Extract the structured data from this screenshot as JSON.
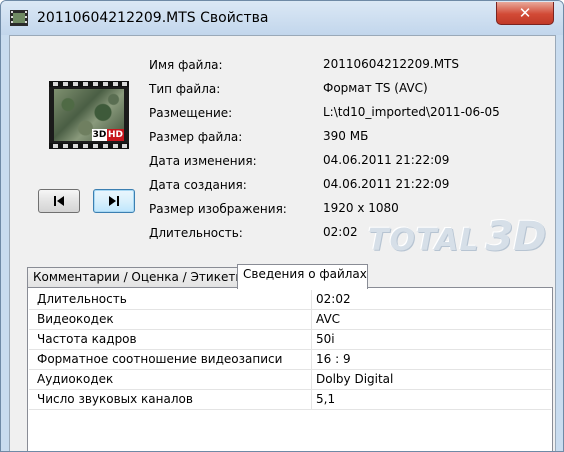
{
  "window": {
    "title": "20110604212209.MTS Свойства",
    "close_label": "✕"
  },
  "thumbnail": {
    "badge_3d": "3D",
    "badge_hd": "HD"
  },
  "nav": {
    "prev_icon": "skip-previous-icon",
    "next_icon": "skip-next-icon"
  },
  "details": [
    {
      "label": "Имя файла:",
      "value": "20110604212209.MTS"
    },
    {
      "label": "Тип файла:",
      "value": "Формат TS (AVC)"
    },
    {
      "label": "Размещение:",
      "value": "L:\\td10_imported\\2011-06-05"
    },
    {
      "label": "Размер файла:",
      "value": "390 МБ"
    },
    {
      "label": "Дата изменения:",
      "value": "04.06.2011 21:22:09"
    },
    {
      "label": "Дата создания:",
      "value": "04.06.2011 21:22:09"
    },
    {
      "label": "Размер изображения:",
      "value": "1920 x 1080"
    },
    {
      "label": "Длительность:",
      "value": "02:02"
    }
  ],
  "logo": {
    "part1": "TOTAL",
    "part2": "3D"
  },
  "tabs": [
    {
      "label": "Комментарии / Оценка / Этикетки",
      "active": false
    },
    {
      "label": "Сведения о файлах",
      "active": true
    }
  ],
  "file_info": [
    {
      "key": "Длительность",
      "value": "02:02"
    },
    {
      "key": "Видеокодек",
      "value": "AVC"
    },
    {
      "key": "Частота кадров",
      "value": "50i"
    },
    {
      "key": "Форматное соотношение видеозаписи",
      "value": "16 : 9"
    },
    {
      "key": "Аудиокодек",
      "value": "Dolby Digital"
    },
    {
      "key": "Число звуковых каналов",
      "value": "5,1"
    }
  ]
}
